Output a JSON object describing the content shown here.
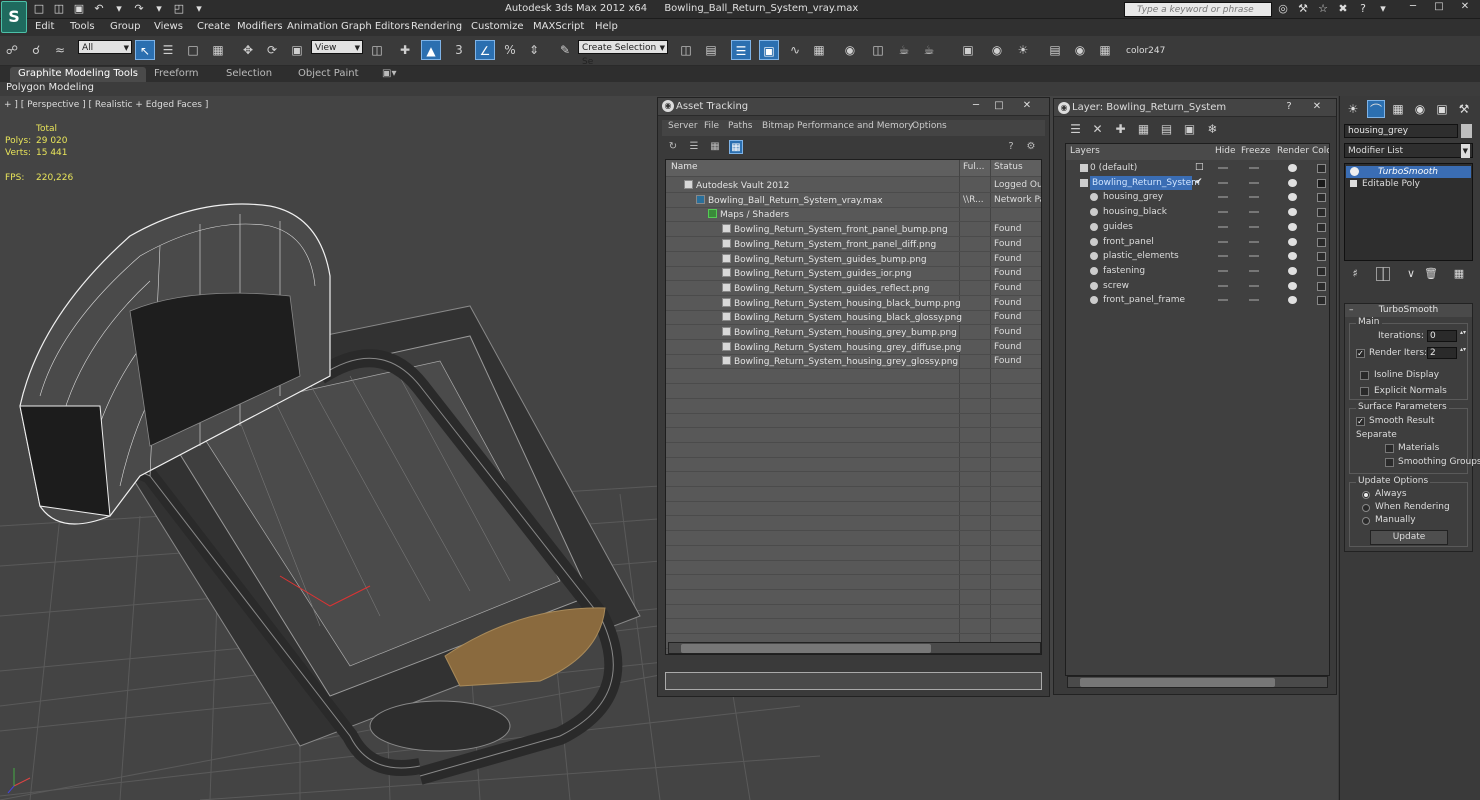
{
  "app": {
    "title": "Autodesk 3ds Max  2012 x64",
    "file": "Bowling_Ball_Return_System_vray.max",
    "logo": "S",
    "search_placeholder": "Type a keyword or phrase"
  },
  "menu": [
    "Edit",
    "Tools",
    "Group",
    "Views",
    "Create",
    "Modifiers",
    "Animation",
    "Graph Editors",
    "Rendering",
    "Customize",
    "MAXScript",
    "Help"
  ],
  "toolbar": {
    "selection_filter": "All",
    "ref_coord": "View",
    "named_sel": "Create Selection Se",
    "snap_num": "3",
    "color_label": "color247"
  },
  "ribbon": {
    "tabs": [
      "Graphite Modeling Tools",
      "Freeform",
      "Selection",
      "Object Paint"
    ],
    "active_panel": "Polygon Modeling"
  },
  "viewport": {
    "label": "+ ] [ Perspective ] [ Realistic + Edged Faces ]",
    "stats_header": "Total",
    "polys_label": "Polys:",
    "polys": "29 020",
    "verts_label": "Verts:",
    "verts": "15 441",
    "fps_label": "FPS:",
    "fps": "220,226"
  },
  "asset_tracking": {
    "title": "Asset Tracking",
    "menu": [
      "Server",
      "File",
      "Paths",
      "Bitmap Performance and Memory",
      "Options"
    ],
    "columns": [
      "Name",
      "Ful...",
      "Status"
    ],
    "rows": [
      {
        "name": "Autodesk Vault 2012",
        "full": "",
        "status": "Logged Out",
        "indent": 1
      },
      {
        "name": "Bowling_Ball_Return_System_vray.max",
        "full": "\\\\R...",
        "status": "Network Pa",
        "indent": 2
      },
      {
        "name": "Maps / Shaders",
        "full": "",
        "status": "",
        "indent": 3
      },
      {
        "name": "Bowling_Return_System_front_panel_bump.png",
        "full": "",
        "status": "Found",
        "indent": 4
      },
      {
        "name": "Bowling_Return_System_front_panel_diff.png",
        "full": "",
        "status": "Found",
        "indent": 4
      },
      {
        "name": "Bowling_Return_System_guides_bump.png",
        "full": "",
        "status": "Found",
        "indent": 4
      },
      {
        "name": "Bowling_Return_System_guides_ior.png",
        "full": "",
        "status": "Found",
        "indent": 4
      },
      {
        "name": "Bowling_Return_System_guides_reflect.png",
        "full": "",
        "status": "Found",
        "indent": 4
      },
      {
        "name": "Bowling_Return_System_housing_black_bump.png",
        "full": "",
        "status": "Found",
        "indent": 4
      },
      {
        "name": "Bowling_Return_System_housing_black_glossy.png",
        "full": "",
        "status": "Found",
        "indent": 4
      },
      {
        "name": "Bowling_Return_System_housing_grey_bump.png",
        "full": "",
        "status": "Found",
        "indent": 4
      },
      {
        "name": "Bowling_Return_System_housing_grey_diffuse.png",
        "full": "",
        "status": "Found",
        "indent": 4
      },
      {
        "name": "Bowling_Return_System_housing_grey_glossy.png",
        "full": "",
        "status": "Found",
        "indent": 4
      }
    ]
  },
  "layer_panel": {
    "title": "Layer: Bowling_Return_System",
    "columns": [
      "Layers",
      "Hide",
      "Freeze",
      "Render",
      "Colo"
    ],
    "layers": [
      {
        "name": "0 (default)",
        "level": 0,
        "selected": false,
        "color": "#2a2a2a"
      },
      {
        "name": "Bowling_Return_System",
        "level": 0,
        "selected": true,
        "color": "#1a1a1a"
      },
      {
        "name": "housing_grey",
        "level": 1,
        "selected": false,
        "color": "#2a2a2a"
      },
      {
        "name": "housing_black",
        "level": 1,
        "selected": false,
        "color": "#2a2a2a"
      },
      {
        "name": "guides",
        "level": 1,
        "selected": false,
        "color": "#2a2a2a"
      },
      {
        "name": "front_panel",
        "level": 1,
        "selected": false,
        "color": "#2a2a2a"
      },
      {
        "name": "plastic_elements",
        "level": 1,
        "selected": false,
        "color": "#2a2a2a"
      },
      {
        "name": "fastening",
        "level": 1,
        "selected": false,
        "color": "#2a2a2a"
      },
      {
        "name": "screw",
        "level": 1,
        "selected": false,
        "color": "#2a2a2a"
      },
      {
        "name": "front_panel_frame",
        "level": 1,
        "selected": false,
        "color": "#2a2a2a"
      }
    ]
  },
  "command_panel": {
    "object_name": "housing_grey",
    "modifier_list": "Modifier List",
    "stack": [
      "TurboSmooth",
      "Editable Poly"
    ],
    "turbosmooth": {
      "title": "TurboSmooth",
      "main": "Main",
      "iterations_label": "Iterations:",
      "iterations": "0",
      "render_iters_label": "Render Iters:",
      "render_iters": "2",
      "isoline": "Isoline Display",
      "explicit_normals": "Explicit Normals",
      "surface_params": "Surface Parameters",
      "smooth_result": "Smooth Result",
      "separate": "Separate",
      "materials": "Materials",
      "smoothing_groups": "Smoothing Groups",
      "update_options": "Update Options",
      "always": "Always",
      "when_rendering": "When Rendering",
      "manually": "Manually",
      "update_button": "Update"
    }
  },
  "colors": {
    "accent": "#2b6fb0",
    "viewport_bg": "#444444",
    "stat_text": "#e8e45a",
    "selection": "#3a6db4"
  }
}
